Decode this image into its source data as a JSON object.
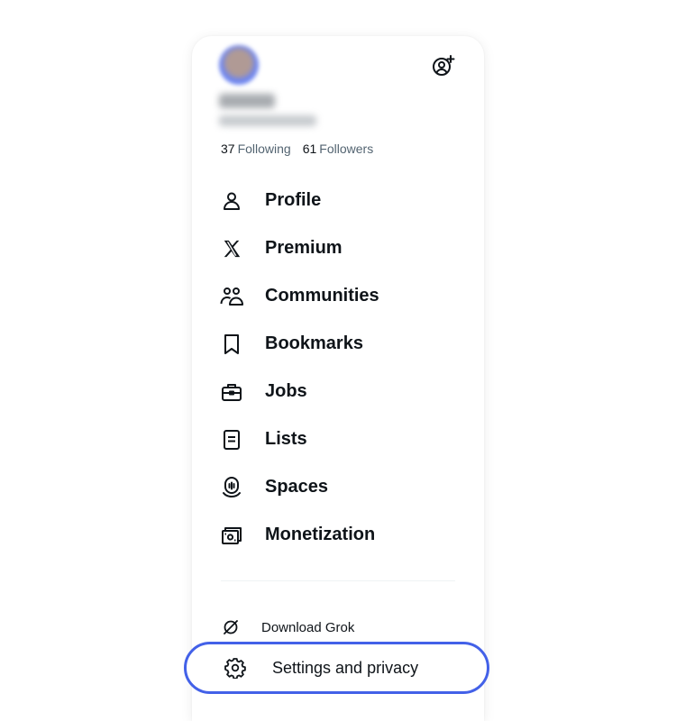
{
  "profile": {
    "following_count": "37",
    "following_label": "Following",
    "followers_count": "61",
    "followers_label": "Followers",
    "add_account_icon": "add-account-icon"
  },
  "menu": {
    "items": [
      {
        "label": "Profile",
        "icon": "person-icon"
      },
      {
        "label": "Premium",
        "icon": "x-logo-icon"
      },
      {
        "label": "Communities",
        "icon": "people-icon"
      },
      {
        "label": "Bookmarks",
        "icon": "bookmark-icon"
      },
      {
        "label": "Jobs",
        "icon": "briefcase-icon"
      },
      {
        "label": "Lists",
        "icon": "list-icon"
      },
      {
        "label": "Spaces",
        "icon": "microphone-icon"
      },
      {
        "label": "Monetization",
        "icon": "money-icon"
      }
    ]
  },
  "footer": {
    "grok_label": "Download Grok",
    "settings_label": "Settings and privacy"
  },
  "colors": {
    "highlight": "#4361e8",
    "text_primary": "#0f1419",
    "text_secondary": "#536471"
  }
}
